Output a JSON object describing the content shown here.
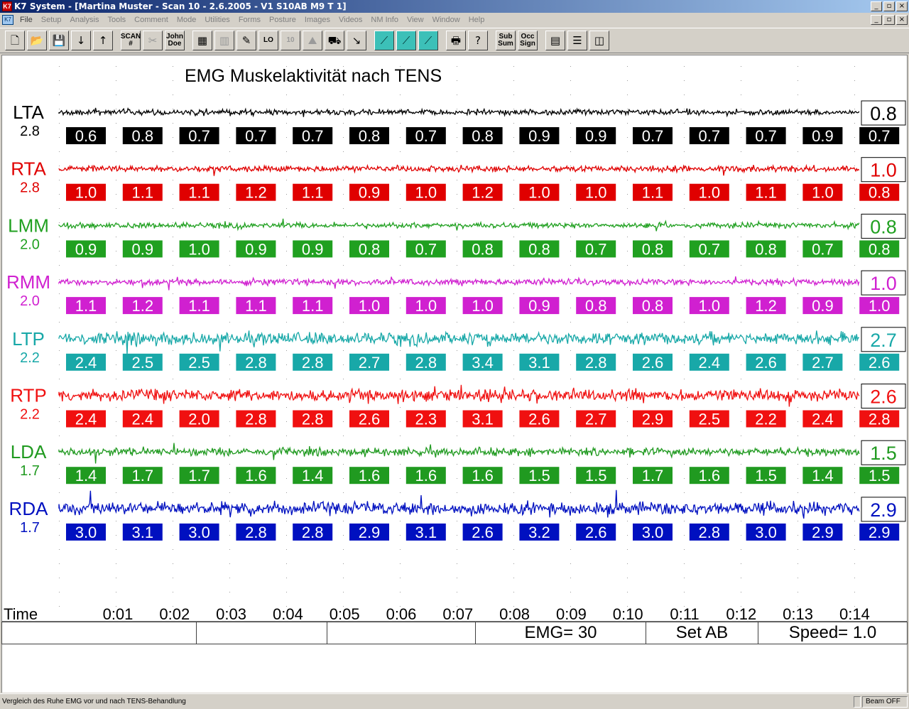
{
  "window": {
    "title": "K7 System - [Martina Muster - Scan 10 - 2.6.2005 - V1 S10AB M9  T 1]",
    "app_icon": "K7",
    "controls": [
      "_",
      "▫",
      "×"
    ]
  },
  "menu": {
    "doc_icon": "K7",
    "items": [
      "File",
      "Setup",
      "Analysis",
      "Tools",
      "Comment",
      "Mode",
      "Utilities",
      "Forms",
      "Posture",
      "Images",
      "Videos",
      "NM Info",
      "View",
      "Window",
      "Help"
    ]
  },
  "toolbar": {
    "buttons": [
      {
        "name": "new-file-button",
        "glyph": "🗋",
        "dim": false
      },
      {
        "name": "open-folder-button",
        "glyph": "📂",
        "dim": false
      },
      {
        "name": "save-button",
        "glyph": "💾",
        "dim": true
      },
      {
        "name": "arrow-down-button",
        "glyph": "↓",
        "dim": false
      },
      {
        "name": "arrow-up-button",
        "glyph": "↑",
        "dim": false
      },
      {
        "name": "scan-number-button",
        "text": "SCAN #",
        "dim": false
      },
      {
        "name": "tools-button",
        "glyph": "✂",
        "dim": true
      },
      {
        "name": "john-doe-button",
        "text": "John Doe",
        "dim": false
      },
      {
        "name": "grid-view-button",
        "glyph": "▦",
        "dim": false
      },
      {
        "name": "bar-view-button",
        "glyph": "▥",
        "dim": true
      },
      {
        "name": "edit-pencil-button",
        "glyph": "✎",
        "dim": false
      },
      {
        "name": "level-button",
        "text": "LO",
        "dim": false
      },
      {
        "name": "compare-button",
        "text": "10",
        "dim": true
      },
      {
        "name": "chart-button",
        "glyph": "⛰",
        "dim": true
      },
      {
        "name": "print-setup-button",
        "glyph": "⛟",
        "dim": false
      },
      {
        "name": "cursor-button",
        "glyph": "↘",
        "dim": false
      },
      {
        "name": "scan-trace-1-button",
        "glyph": "⟋",
        "teal": true
      },
      {
        "name": "scan-trace-2-button",
        "glyph": "⟋",
        "teal": true
      },
      {
        "name": "scan-trace-3-button",
        "glyph": "⟋",
        "teal": true
      },
      {
        "name": "print-button",
        "glyph": "🖶",
        "dim": false
      },
      {
        "name": "help-button",
        "glyph": "?",
        "dim": false
      },
      {
        "name": "sub-sum-button",
        "text": "Sub Sum",
        "dim": false
      },
      {
        "name": "occ-sign-button",
        "text": "Occ Sign",
        "dim": false
      },
      {
        "name": "cascade-button",
        "glyph": "▤",
        "dim": false
      },
      {
        "name": "tile-horizontal-button",
        "glyph": "☰",
        "dim": false
      },
      {
        "name": "tile-vertical-button",
        "glyph": "◫",
        "dim": false
      }
    ]
  },
  "chart_data": {
    "type": "line",
    "title": "EMG Muskelaktivität nach TENS",
    "xlabel": "Time",
    "x_ticks": [
      "0:01",
      "0:02",
      "0:03",
      "0:04",
      "0:05",
      "0:06",
      "0:07",
      "0:08",
      "0:09",
      "0:10",
      "0:11",
      "0:12",
      "0:13",
      "0:14"
    ],
    "channels": [
      {
        "name": "LTA",
        "scale": "2.8",
        "color": "#000000",
        "amplitude": 0.8,
        "current": "0.8",
        "values": [
          "0.6",
          "0.8",
          "0.7",
          "0.7",
          "0.7",
          "0.8",
          "0.7",
          "0.8",
          "0.9",
          "0.9",
          "0.7",
          "0.7",
          "0.7",
          "0.9",
          "0.7"
        ]
      },
      {
        "name": "RTA",
        "scale": "2.8",
        "color": "#e00000",
        "amplitude": 1.0,
        "current": "1.0",
        "values": [
          "1.0",
          "1.1",
          "1.1",
          "1.2",
          "1.1",
          "0.9",
          "1.0",
          "1.2",
          "1.0",
          "1.0",
          "1.1",
          "1.0",
          "1.1",
          "1.0",
          "0.8"
        ]
      },
      {
        "name": "LMM",
        "scale": "2.0",
        "color": "#20a020",
        "amplitude": 0.8,
        "current": "0.8",
        "values": [
          "0.9",
          "0.9",
          "1.0",
          "0.9",
          "0.9",
          "0.8",
          "0.7",
          "0.8",
          "0.8",
          "0.7",
          "0.8",
          "0.7",
          "0.8",
          "0.7",
          "0.8"
        ]
      },
      {
        "name": "RMM",
        "scale": "2.0",
        "color": "#d020d0",
        "amplitude": 1.0,
        "current": "1.0",
        "values": [
          "1.1",
          "1.2",
          "1.1",
          "1.1",
          "1.1",
          "1.0",
          "1.0",
          "1.0",
          "0.9",
          "0.8",
          "0.8",
          "1.0",
          "1.2",
          "0.9",
          "1.0"
        ]
      },
      {
        "name": "LTP",
        "scale": "2.2",
        "color": "#18a8a8",
        "amplitude": 2.7,
        "current": "2.7",
        "values": [
          "2.4",
          "2.5",
          "2.5",
          "2.8",
          "2.8",
          "2.7",
          "2.8",
          "3.4",
          "3.1",
          "2.8",
          "2.6",
          "2.4",
          "2.6",
          "2.7",
          "2.6"
        ]
      },
      {
        "name": "RTP",
        "scale": "2.2",
        "color": "#f01010",
        "amplitude": 2.6,
        "current": "2.6",
        "values": [
          "2.4",
          "2.4",
          "2.0",
          "2.8",
          "2.8",
          "2.6",
          "2.3",
          "3.1",
          "2.6",
          "2.7",
          "2.9",
          "2.5",
          "2.2",
          "2.4",
          "2.8"
        ]
      },
      {
        "name": "LDA",
        "scale": "1.7",
        "color": "#209a20",
        "amplitude": 1.5,
        "current": "1.5",
        "values": [
          "1.4",
          "1.7",
          "1.7",
          "1.6",
          "1.4",
          "1.6",
          "1.6",
          "1.6",
          "1.5",
          "1.5",
          "1.7",
          "1.6",
          "1.5",
          "1.4",
          "1.5"
        ]
      },
      {
        "name": "RDA",
        "scale": "1.7",
        "color": "#0010c0",
        "amplitude": 2.9,
        "current": "2.9",
        "values": [
          "3.0",
          "3.1",
          "3.0",
          "2.8",
          "2.8",
          "2.9",
          "3.1",
          "2.6",
          "3.2",
          "2.6",
          "3.0",
          "2.8",
          "3.0",
          "2.9",
          "2.9"
        ]
      }
    ]
  },
  "status_row": {
    "cells": [
      "",
      "",
      "",
      "EMG= 30",
      "Set AB",
      "Speed= 1.0"
    ]
  },
  "statusbar": {
    "message": "Vergleich des Ruhe EMG vor und nach TENS-Behandlung",
    "beam": "Beam OFF"
  }
}
